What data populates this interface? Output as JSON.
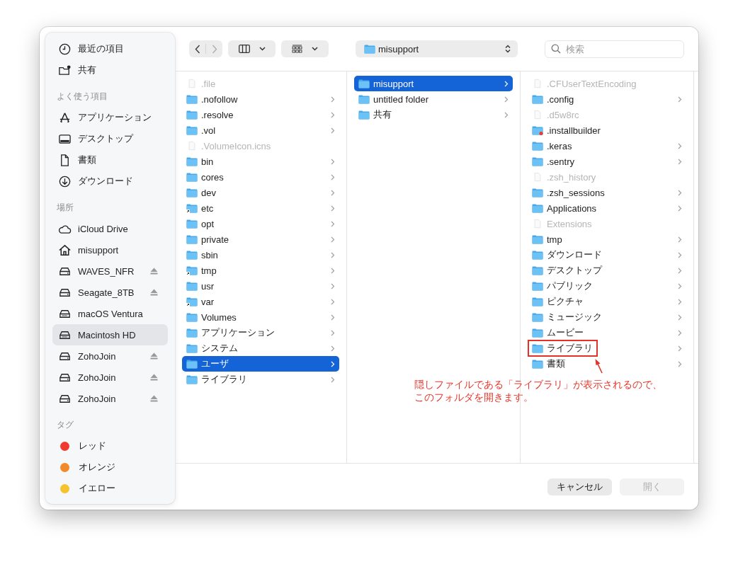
{
  "sidebar": {
    "sections": [
      {
        "items": [
          {
            "label": "最近の項目",
            "kind": "clock",
            "selected": false,
            "eject": false
          },
          {
            "label": "共有",
            "kind": "shared",
            "selected": false,
            "eject": false
          }
        ]
      },
      {
        "heading": "よく使う項目",
        "items": [
          {
            "label": "アプリケーション",
            "kind": "apps",
            "selected": false,
            "eject": false
          },
          {
            "label": "デスクトップ",
            "kind": "desktop",
            "selected": false,
            "eject": false
          },
          {
            "label": "書類",
            "kind": "document",
            "selected": false,
            "eject": false
          },
          {
            "label": "ダウンロード",
            "kind": "download",
            "selected": false,
            "eject": false
          }
        ]
      },
      {
        "heading": "場所",
        "items": [
          {
            "label": "iCloud Drive",
            "kind": "cloud",
            "selected": false,
            "eject": false
          },
          {
            "label": "misupport",
            "kind": "home",
            "selected": false,
            "eject": false
          },
          {
            "label": "WAVES_NFR",
            "kind": "drive",
            "selected": false,
            "eject": true
          },
          {
            "label": "Seagate_8TB",
            "kind": "drive",
            "selected": false,
            "eject": true
          },
          {
            "label": "macOS Ventura",
            "kind": "internal",
            "selected": false,
            "eject": false
          },
          {
            "label": "Macintosh HD",
            "kind": "internal",
            "selected": true,
            "eject": false
          },
          {
            "label": "ZohoJoin",
            "kind": "drive",
            "selected": false,
            "eject": true
          },
          {
            "label": "ZohoJoin",
            "kind": "drive",
            "selected": false,
            "eject": true
          },
          {
            "label": "ZohoJoin",
            "kind": "drive",
            "selected": false,
            "eject": true
          }
        ]
      }
    ],
    "tags": {
      "heading": "タグ",
      "items": [
        {
          "label": "レッド",
          "color": "#f03a30"
        },
        {
          "label": "オレンジ",
          "color": "#f28a2a"
        },
        {
          "label": "イエロー",
          "color": "#f5c32c"
        }
      ]
    }
  },
  "toolbar": {
    "path_popup": "misupport",
    "search": {
      "placeholder": "検索"
    }
  },
  "columns": [
    {
      "items": [
        {
          "name": ".file",
          "kind": "file",
          "selected": false,
          "highlighted": false
        },
        {
          "name": ".nofollow",
          "kind": "folder",
          "selected": false,
          "highlighted": false
        },
        {
          "name": ".resolve",
          "kind": "folder",
          "selected": false,
          "highlighted": false
        },
        {
          "name": ".vol",
          "kind": "folder",
          "selected": false,
          "highlighted": false
        },
        {
          "name": ".VolumeIcon.icns",
          "kind": "file",
          "selected": false,
          "highlighted": false
        },
        {
          "name": "bin",
          "kind": "folder",
          "selected": false,
          "highlighted": false
        },
        {
          "name": "cores",
          "kind": "folder",
          "selected": false,
          "highlighted": false
        },
        {
          "name": "dev",
          "kind": "folder",
          "selected": false,
          "highlighted": false
        },
        {
          "name": "etc",
          "kind": "alias",
          "selected": false,
          "highlighted": false
        },
        {
          "name": "opt",
          "kind": "folder",
          "selected": false,
          "highlighted": false
        },
        {
          "name": "private",
          "kind": "folder",
          "selected": false,
          "highlighted": false
        },
        {
          "name": "sbin",
          "kind": "folder",
          "selected": false,
          "highlighted": false
        },
        {
          "name": "tmp",
          "kind": "alias",
          "selected": false,
          "highlighted": false
        },
        {
          "name": "usr",
          "kind": "folder",
          "selected": false,
          "highlighted": false
        },
        {
          "name": "var",
          "kind": "alias",
          "selected": false,
          "highlighted": false
        },
        {
          "name": "Volumes",
          "kind": "folder",
          "selected": false,
          "highlighted": false
        },
        {
          "name": "アプリケーション",
          "kind": "folder",
          "selected": false,
          "highlighted": false
        },
        {
          "name": "システム",
          "kind": "folder",
          "selected": false,
          "highlighted": false
        },
        {
          "name": "ユーザ",
          "kind": "folder",
          "selected": true,
          "highlighted": false
        },
        {
          "name": "ライブラリ",
          "kind": "folder",
          "selected": false,
          "highlighted": false
        }
      ]
    },
    {
      "items": [
        {
          "name": "misupport",
          "kind": "folder",
          "selected": true,
          "highlighted": false
        },
        {
          "name": "untitled folder",
          "kind": "folder",
          "selected": false,
          "highlighted": false
        },
        {
          "name": "共有",
          "kind": "folder",
          "selected": false,
          "highlighted": false
        }
      ]
    },
    {
      "items": [
        {
          "name": ".CFUserTextEncoding",
          "kind": "file",
          "selected": false,
          "highlighted": false
        },
        {
          "name": ".config",
          "kind": "folder",
          "selected": false,
          "highlighted": false
        },
        {
          "name": ".d5w8rc",
          "kind": "file",
          "selected": false,
          "highlighted": false
        },
        {
          "name": ".installbuilder",
          "kind": "badged",
          "selected": false,
          "highlighted": false
        },
        {
          "name": ".keras",
          "kind": "folder",
          "selected": false,
          "highlighted": false
        },
        {
          "name": ".sentry",
          "kind": "folder",
          "selected": false,
          "highlighted": false
        },
        {
          "name": ".zsh_history",
          "kind": "file",
          "selected": false,
          "highlighted": false
        },
        {
          "name": ".zsh_sessions",
          "kind": "folder",
          "selected": false,
          "highlighted": false
        },
        {
          "name": "Applications",
          "kind": "folder",
          "selected": false,
          "highlighted": false
        },
        {
          "name": "Extensions",
          "kind": "file",
          "selected": false,
          "highlighted": false
        },
        {
          "name": "tmp",
          "kind": "folder",
          "selected": false,
          "highlighted": false
        },
        {
          "name": "ダウンロード",
          "kind": "folder",
          "selected": false,
          "highlighted": false
        },
        {
          "name": "デスクトップ",
          "kind": "folder",
          "selected": false,
          "highlighted": false
        },
        {
          "name": "パブリック",
          "kind": "folder",
          "selected": false,
          "highlighted": false
        },
        {
          "name": "ピクチャ",
          "kind": "folder",
          "selected": false,
          "highlighted": false
        },
        {
          "name": "ミュージック",
          "kind": "folder",
          "selected": false,
          "highlighted": false
        },
        {
          "name": "ムービー",
          "kind": "folder",
          "selected": false,
          "highlighted": false
        },
        {
          "name": "ライブラリ",
          "kind": "folder",
          "selected": false,
          "highlighted": true
        },
        {
          "name": "書類",
          "kind": "folder",
          "selected": false,
          "highlighted": false
        }
      ]
    }
  ],
  "annotation": [
    "隠しファイルである「ライブラリ」が表示されるので、",
    "このフォルダを開きます。"
  ],
  "buttons": [
    {
      "label": "キャンセル",
      "disabled": false
    },
    {
      "label": "開く",
      "disabled": true
    }
  ]
}
